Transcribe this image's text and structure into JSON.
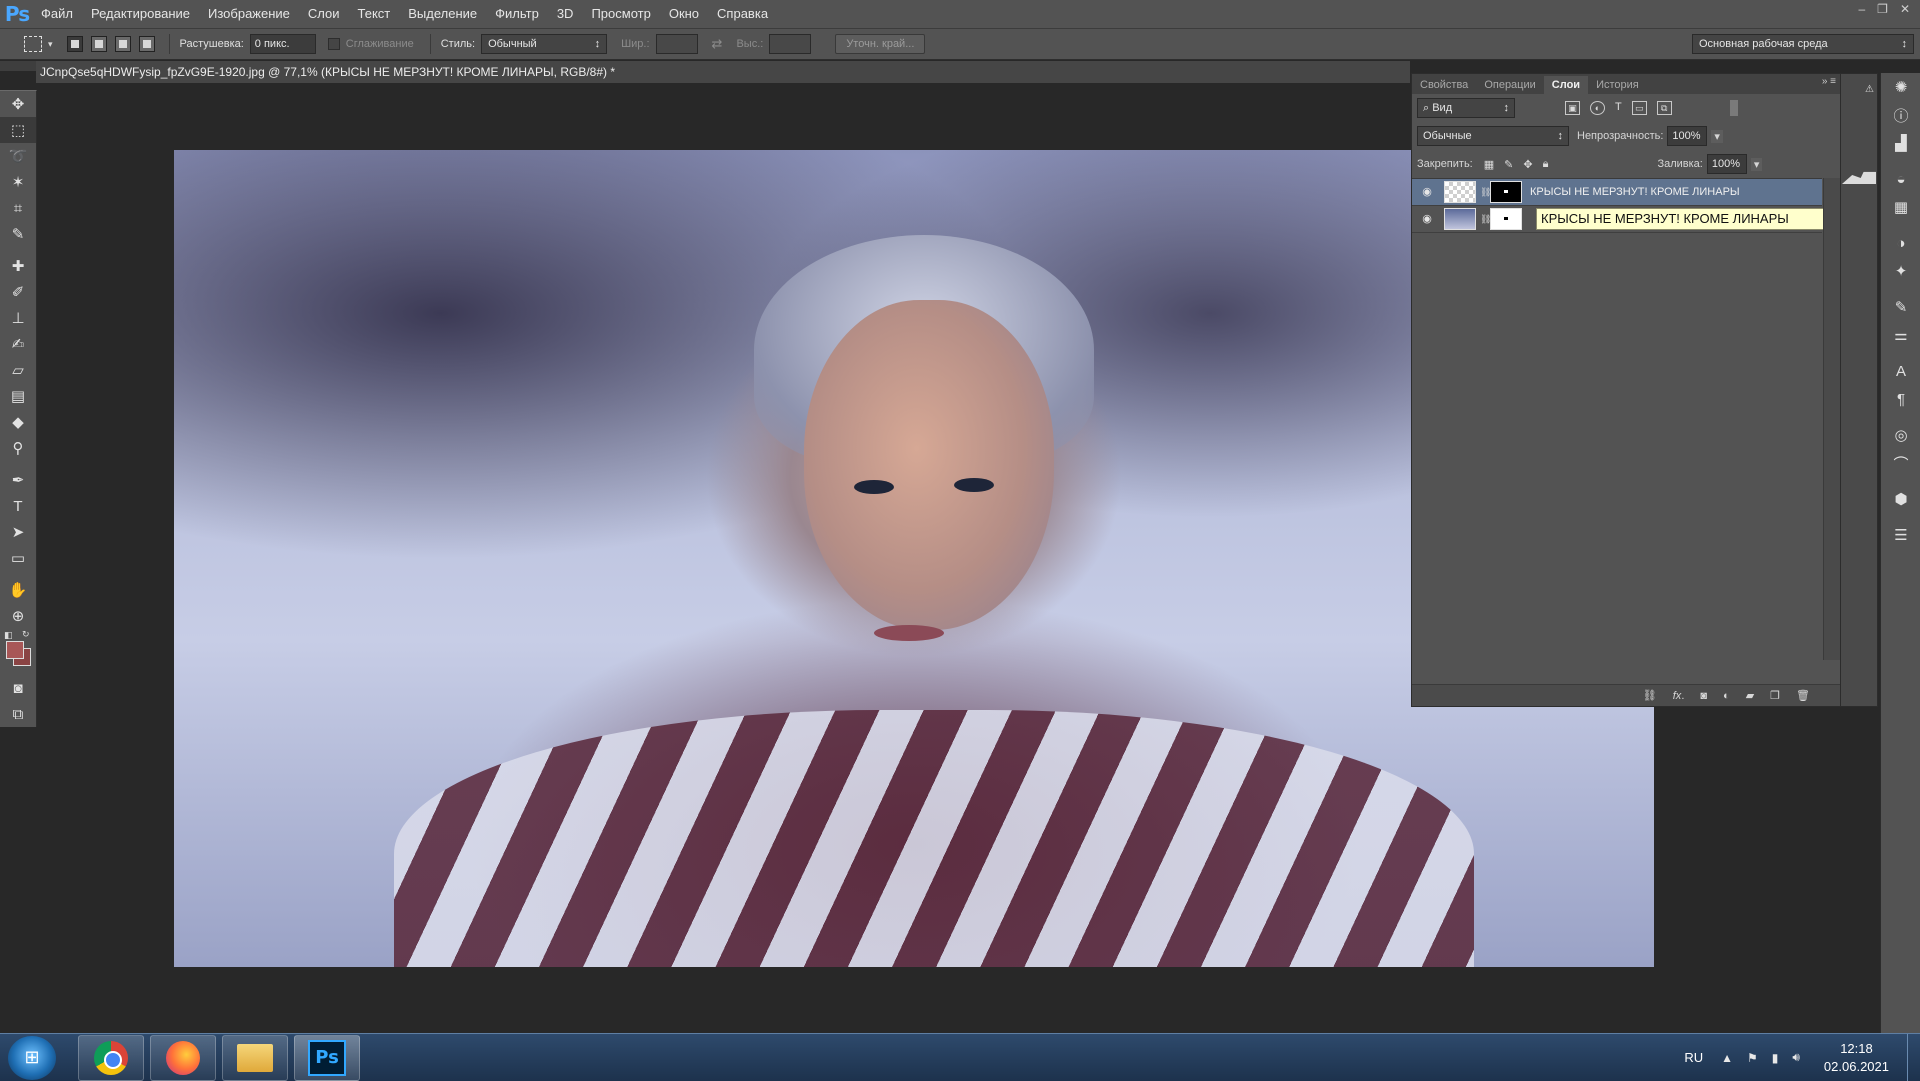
{
  "app": {
    "logo": "Ps",
    "menu": [
      "Файл",
      "Редактирование",
      "Изображение",
      "Слои",
      "Текст",
      "Выделение",
      "Фильтр",
      "3D",
      "Просмотр",
      "Окно",
      "Справка"
    ],
    "window_controls": {
      "minimize": "‒",
      "restore": "❐",
      "close": "✕"
    }
  },
  "options": {
    "feather_label": "Растушевка:",
    "feather_value": "0 пикс.",
    "antialias_label": "Сглаживание",
    "style_label": "Стиль:",
    "style_value": "Обычный",
    "width_label": "Шир.:",
    "height_label": "Выс.:",
    "refine_edge": "Уточн. край...",
    "workspace": "Основная рабочая среда"
  },
  "document": {
    "tab_title": "JCnpQse5qHDWFysip_fpZvG9E-1920.jpg @ 77,1% (КРЫСЫ НЕ МЕРЗНУТ! КРОМЕ ЛИНАРЫ, RGB/8#) *"
  },
  "panel": {
    "tabs": [
      "Свойства",
      "Операции",
      "Слои",
      "История"
    ],
    "active_tab": "Слои",
    "filter_kind": "Вид",
    "blend_mode": "Обычные",
    "opacity_label": "Непрозрачность:",
    "opacity_value": "100%",
    "lock_label": "Закрепить:",
    "fill_label": "Заливка:",
    "fill_value": "100%",
    "layers": [
      {
        "name": "КРЫСЫ НЕ МЕРЗНУТ! КРОМЕ ЛИНАРЫ",
        "selected": true,
        "visible": true
      },
      {
        "name": "",
        "selected": false,
        "visible": true,
        "editing_text": "КРЫСЫ НЕ МЕРЗНУТ! КРОМЕ ЛИНАРЫ"
      }
    ],
    "bottom_icons": [
      "link-icon",
      "fx-icon",
      "mask-icon",
      "adjustment-icon",
      "folder-icon",
      "new-layer-icon",
      "trash-icon"
    ]
  },
  "taskbar": {
    "apps": [
      "Chrome",
      "Firefox",
      "Explorer",
      "Photoshop"
    ],
    "language": "RU",
    "time": "12:18",
    "date": "02.06.2021"
  },
  "colors": {
    "foreground": "#a85757",
    "background": "#8a4444",
    "selection": "#5f738f",
    "rename_field": "#ffffcc"
  }
}
